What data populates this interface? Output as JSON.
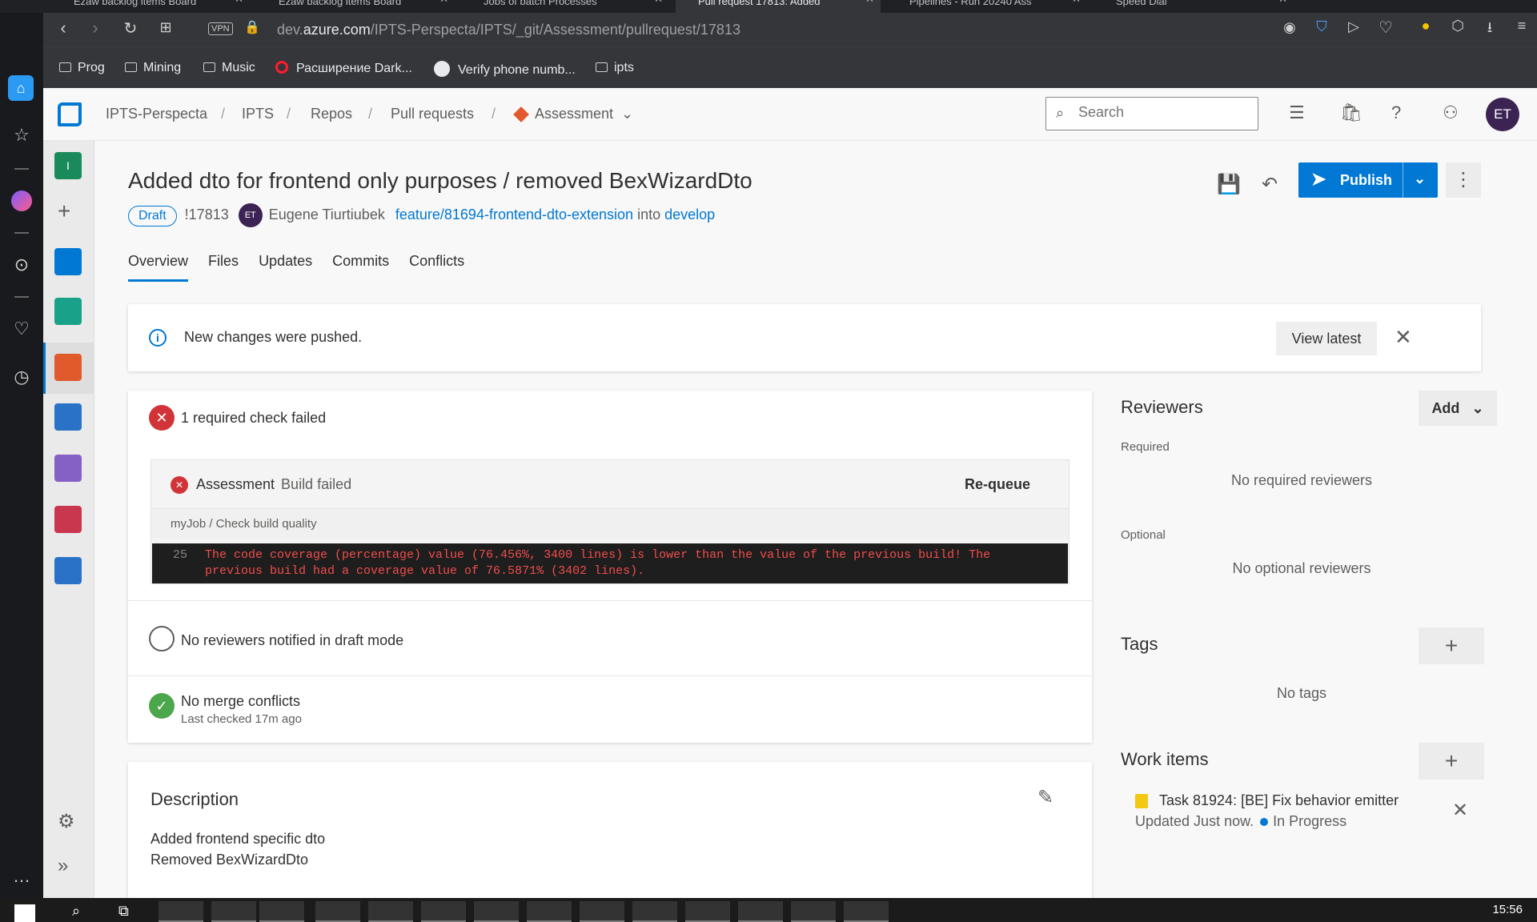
{
  "browser": {
    "tabs": [
      {
        "label": "Ezaw backlog items Board",
        "active": false
      },
      {
        "label": "Ezaw backlog items Board",
        "active": false
      },
      {
        "label": "Jobs of batch Processes",
        "active": false
      },
      {
        "label": "Pull request 17813: Added",
        "active": true
      },
      {
        "label": "Pipelines - Run 20240 Ass",
        "active": false
      },
      {
        "label": "Speed Dial",
        "active": false
      }
    ],
    "url_prefix": "dev.",
    "url_domain": "azure.com",
    "url_path": "/IPTS-Perspecta/IPTS/_git/Assessment/pullrequest/17813",
    "vpn_label": "VPN",
    "bookmarks": [
      "Prog",
      "Mining",
      "Music",
      "Расширение Dark...",
      "Verify phone numb...",
      "ipts"
    ]
  },
  "header": {
    "breadcrumbs": [
      "IPTS-Perspecta",
      "IPTS",
      "Repos",
      "Pull requests",
      "Assessment"
    ],
    "search_placeholder": "Search",
    "avatar_initials": "ET"
  },
  "pr": {
    "title": "Added dto for frontend only purposes / removed BexWizardDto",
    "status_badge": "Draft",
    "id": "!17813",
    "author_initials": "ET",
    "author": "Eugene Tiurtiubek",
    "source_branch": "feature/81694-frontend-dto-extension",
    "into_word": "into",
    "target_branch": "develop",
    "publish_label": "Publish",
    "tabs": [
      "Overview",
      "Files",
      "Updates",
      "Commits",
      "Conflicts"
    ]
  },
  "notice": {
    "message": "New changes were pushed.",
    "button": "View latest"
  },
  "checks": {
    "failed_title": "1 required check failed",
    "build_name": "Assessment",
    "build_state": "Build failed",
    "requeue": "Re-queue",
    "job": "myJob / Check build quality",
    "log_line_number": "25",
    "log_text": "The code coverage (percentage) value (76.456%, 3400 lines) is lower than the value of the previous build! The previous build had a coverage value of 76.5871% (3402 lines).",
    "reviewers_status": "No reviewers notified in draft mode",
    "merge_status": "No merge conflicts",
    "merge_checked": "Last checked 17m ago"
  },
  "description": {
    "heading": "Description",
    "line1": "Added frontend specific dto",
    "line2": "Removed BexWizardDto"
  },
  "sidebar_right": {
    "reviewers_heading": "Reviewers",
    "add_label": "Add",
    "required_label": "Required",
    "no_required": "No required reviewers",
    "optional_label": "Optional",
    "no_optional": "No optional reviewers",
    "tags_heading": "Tags",
    "no_tags": "No tags",
    "work_items_heading": "Work items",
    "work_item_title": "Task 81924: [BE] Fix behavior emitter",
    "work_item_updated": "Updated Just now.",
    "work_item_state": "In Progress"
  },
  "taskbar": {
    "clock": "15:56"
  },
  "colors": {
    "accent": "#0078d4",
    "error": "#d13438",
    "success": "#4ca64c"
  }
}
